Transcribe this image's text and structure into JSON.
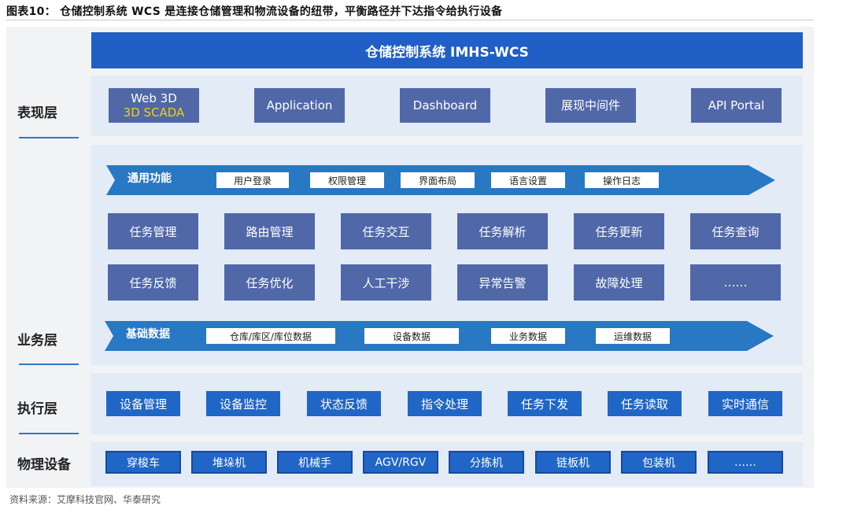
{
  "figure_title": "图表10：  仓储控制系统 WCS 是连接仓储管理和物流设备的纽带，平衡路径并下达指令给执行设备",
  "banner": "仓储控制系统 IMHS-WCS",
  "layers": {
    "presentation": "表现层",
    "business": "业务层",
    "execution": "执行层",
    "devices": "物理设备"
  },
  "presentation_items": [
    {
      "line1": "Web 3D",
      "line2": "3D SCADA"
    },
    {
      "line1": "Application"
    },
    {
      "line1": "Dashboard"
    },
    {
      "line1": "展现中间件"
    },
    {
      "line1": "API Portal"
    }
  ],
  "general": {
    "title": "通用功能",
    "chips": [
      "用户登录",
      "权限管理",
      "界面布局",
      "语言设置",
      "操作日志"
    ]
  },
  "tasks_row1": [
    "任务管理",
    "路由管理",
    "任务交互",
    "任务解析",
    "任务更新",
    "任务查询"
  ],
  "tasks_row2": [
    "任务反馈",
    "任务优化",
    "人工干涉",
    "异常告警",
    "故障处理",
    "……"
  ],
  "basic_data": {
    "title": "基础数据",
    "chips": [
      "仓库/库区/库位数据",
      "设备数据",
      "业务数据",
      "运维数据"
    ]
  },
  "execution_items": [
    "设备管理",
    "设备监控",
    "状态反馈",
    "指令处理",
    "任务下发",
    "任务读取",
    "实时通信"
  ],
  "device_items": [
    "穿梭车",
    "堆垛机",
    "机械手",
    "AGV/RGV",
    "分拣机",
    "链板机",
    "包装机",
    "……"
  ],
  "source": "资料来源：艾摩科技官网、华泰研究",
  "colors": {
    "banner": "#1f5fc6",
    "box_purple_blue": "#5068a8",
    "arrow_blue": "#2878c3",
    "box_blue": "#2066c6",
    "band_light": "#e3ebf6",
    "accent_yellow": "#f2d200"
  }
}
